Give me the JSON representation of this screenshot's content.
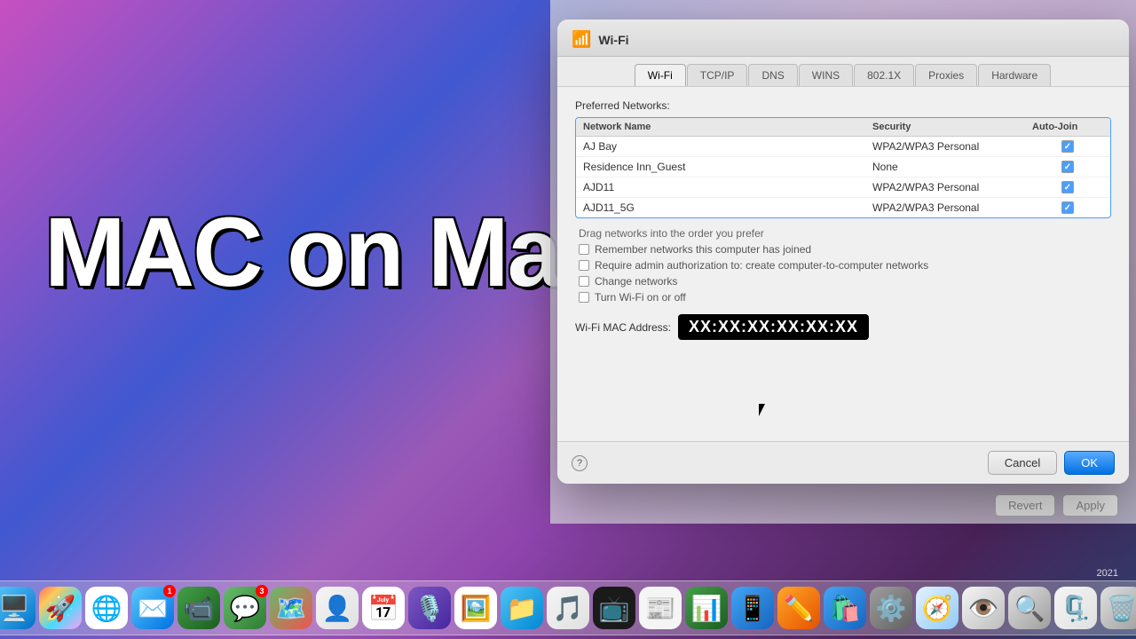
{
  "desktop": {
    "overlay_text": "MAC on Mac"
  },
  "dialog": {
    "title": "Wi-Fi",
    "tabs": [
      "Wi-Fi",
      "TCP/IP",
      "DNS",
      "WINS",
      "802.1X",
      "Proxies",
      "Hardware"
    ],
    "active_tab": "Wi-Fi",
    "section_title": "Preferred Networks:",
    "table": {
      "headers": [
        "Network Name",
        "Security",
        "Auto-Join"
      ],
      "rows": [
        {
          "name": "AJ Bay",
          "security": "WPA2/WPA3 Personal",
          "auto_join": true
        },
        {
          "name": "Residence Inn_Guest",
          "security": "None",
          "auto_join": true
        },
        {
          "name": "AJD11",
          "security": "WPA2/WPA3 Personal",
          "auto_join": true
        },
        {
          "name": "AJD11_5G",
          "security": "WPA2/WPA3 Personal",
          "auto_join": true
        }
      ]
    },
    "options": [
      "Drag networks into the order you prefer",
      "Remember networks this computer has joined",
      "Require admin authorization to: create computer-to-computer networks",
      "Change networks",
      "Turn Wi-Fi on or off"
    ],
    "mac_label": "Wi-Fi MAC Address:",
    "mac_value": "XX:XX:XX:XX:XX:XX",
    "footer": {
      "help": "?",
      "cancel": "Cancel",
      "ok": "OK"
    }
  },
  "bottom_bar": {
    "revert": "Revert",
    "apply": "Apply",
    "year": "2021"
  },
  "dock": {
    "icons": [
      {
        "name": "Finder",
        "class": "finder",
        "emoji": "🖥️",
        "badge": false
      },
      {
        "name": "Launchpad",
        "class": "launchpad",
        "emoji": "🚀",
        "badge": false
      },
      {
        "name": "Chrome",
        "class": "chrome",
        "emoji": "🔵",
        "badge": false
      },
      {
        "name": "Mail",
        "class": "mail",
        "emoji": "✉️",
        "badge": true,
        "badge_count": "1"
      },
      {
        "name": "FaceTime",
        "class": "facetime",
        "emoji": "📹",
        "badge": false
      },
      {
        "name": "Messages",
        "class": "messages",
        "emoji": "💬",
        "badge": true,
        "badge_count": "3"
      },
      {
        "name": "Maps",
        "class": "maps",
        "emoji": "🗺️",
        "badge": false
      },
      {
        "name": "Contacts",
        "class": "contacts",
        "emoji": "👤",
        "badge": false
      },
      {
        "name": "Calendar",
        "class": "calendar",
        "emoji": "📅",
        "badge": false
      },
      {
        "name": "Podcasts",
        "class": "podcasts",
        "emoji": "🎙️",
        "badge": false
      },
      {
        "name": "Photos",
        "class": "photos",
        "emoji": "🖼️",
        "badge": false
      },
      {
        "name": "Files",
        "class": "files",
        "emoji": "📁",
        "badge": false
      },
      {
        "name": "Music",
        "class": "music",
        "emoji": "🎵",
        "badge": false
      },
      {
        "name": "Apple TV",
        "class": "appletv",
        "emoji": "📺",
        "badge": false
      },
      {
        "name": "News",
        "class": "news",
        "emoji": "📰",
        "badge": false
      },
      {
        "name": "Numbers",
        "class": "numbers",
        "emoji": "📊",
        "badge": false
      },
      {
        "name": "iPhone Mirroring",
        "class": "iphone",
        "emoji": "📱",
        "badge": false
      },
      {
        "name": "Pencil",
        "class": "pencil",
        "emoji": "✏️",
        "badge": false
      },
      {
        "name": "App Store",
        "class": "appstore",
        "emoji": "🛍️",
        "badge": false
      },
      {
        "name": "System Preferences",
        "class": "syspreferences",
        "emoji": "⚙️",
        "badge": false
      },
      {
        "name": "Safari",
        "class": "safari",
        "emoji": "🧭",
        "badge": false
      },
      {
        "name": "Preview",
        "class": "preview",
        "emoji": "👁️",
        "badge": false
      },
      {
        "name": "Spotlight",
        "class": "spotlight",
        "emoji": "🔍",
        "badge": false
      },
      {
        "name": "Archive",
        "class": "archive",
        "emoji": "🗜️",
        "badge": false
      },
      {
        "name": "Trash",
        "class": "trash",
        "emoji": "🗑️",
        "badge": false
      }
    ]
  }
}
